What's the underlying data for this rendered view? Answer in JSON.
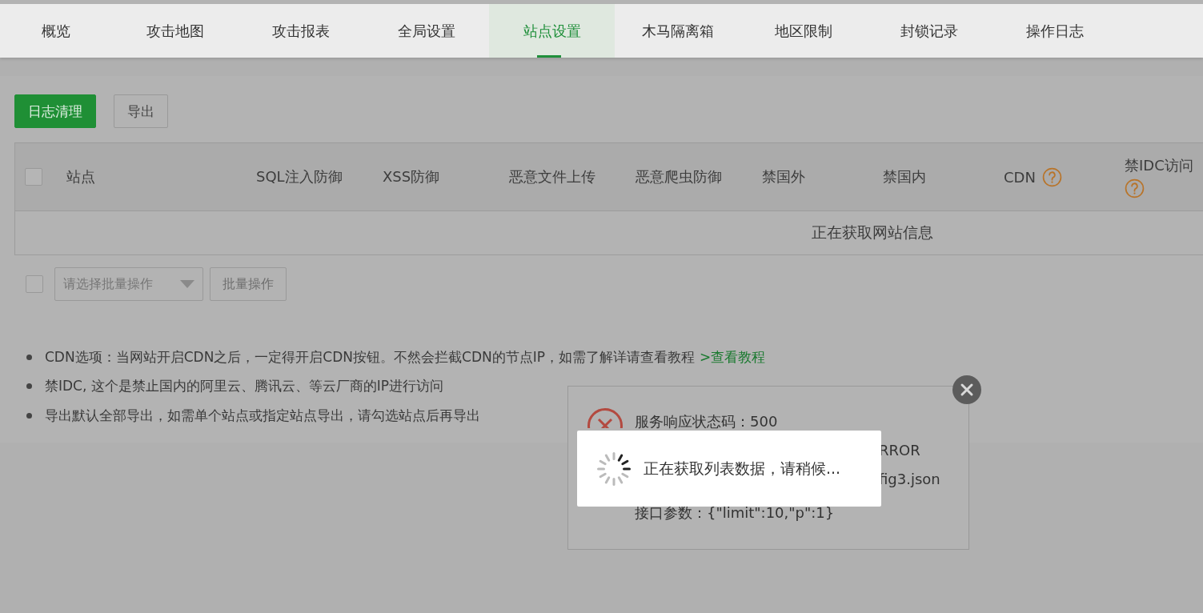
{
  "tabs": [
    {
      "label": "概览",
      "selected": false
    },
    {
      "label": "攻击地图",
      "selected": false
    },
    {
      "label": "攻击报表",
      "selected": false
    },
    {
      "label": "全局设置",
      "selected": false
    },
    {
      "label": "站点设置",
      "selected": true
    },
    {
      "label": "木马隔离箱",
      "selected": false
    },
    {
      "label": "地区限制",
      "selected": false
    },
    {
      "label": "封锁记录",
      "selected": false
    },
    {
      "label": "操作日志",
      "selected": false
    }
  ],
  "toolbar": [
    {
      "label": "日志清理",
      "kind": "primary"
    },
    {
      "label": "导出",
      "kind": "default"
    }
  ],
  "table": {
    "select_all": {
      "checked": false
    },
    "columns": [
      {
        "label": "站点"
      },
      {
        "label": "SQL注入防御"
      },
      {
        "label": "XSS防御"
      },
      {
        "label": "恶意文件上传"
      },
      {
        "label": "恶意爬虫防御"
      },
      {
        "label": "禁国外"
      },
      {
        "label": "禁国内"
      },
      {
        "label": "CDN",
        "help": true
      },
      {
        "label": "禁IDC访问",
        "help": true
      }
    ],
    "empty_message": "正在获取网站信息"
  },
  "batch": {
    "checkbox": {
      "checked": false
    },
    "select": {
      "placeholder": "请选择批量操作"
    },
    "button": "批量操作"
  },
  "notes": [
    {
      "text": "CDN选项：当网站开启CDN之后，一定得开启CDN按钮。不然会拦截CDN的节点IP，如需了解详请查看教程",
      "link": ">查看教程"
    },
    {
      "text": "禁IDC, 这个是禁止国内的阿里云、腾讯云、等云厂商的IP进行访问"
    },
    {
      "text": "导出默认全部导出，如需单个站点或指定站点导出，请勾选站点后再导出"
    }
  ],
  "error_dialog": {
    "lines": [
      {
        "text": "服务响应状态码：500",
        "kind": "full"
      },
      {
        "text": "RROR",
        "kind": "tail"
      },
      {
        "text": "fig3.json",
        "kind": "tail"
      },
      {
        "text": "接口参数：{\"limit\":10,\"p\":1}",
        "kind": "full"
      }
    ]
  },
  "loading": {
    "message": "正在获取列表数据，请稍候..."
  }
}
